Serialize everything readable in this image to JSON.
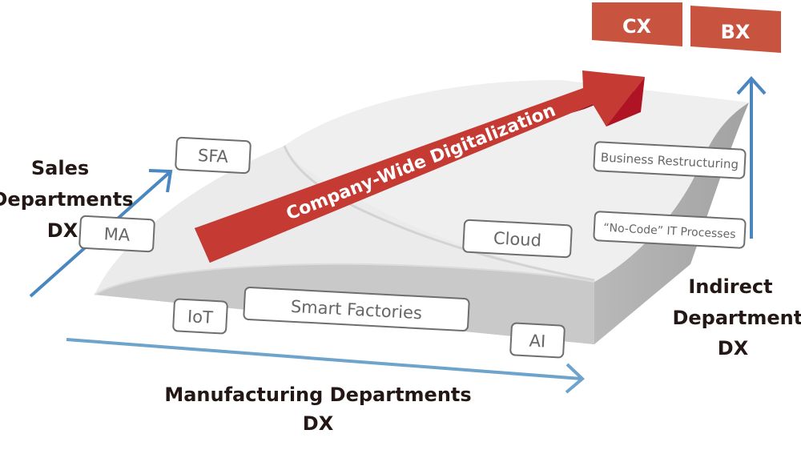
{
  "title": "Company-Wide Digitalization",
  "colors": {
    "accent_red": "#c0392f",
    "badge_red": "#c85440",
    "axis_blue": "#4a86c0",
    "surface_light": "#ececec",
    "surface_mid": "#c8c8c8",
    "surface_dark": "#a9a9a9",
    "tag_border": "#6e6e6e",
    "label_text": "#231815"
  },
  "badges": [
    {
      "label": "CX"
    },
    {
      "label": "BX"
    }
  ],
  "axes": {
    "sales": {
      "line1": "Sales",
      "line2": "Departments",
      "line3": "DX"
    },
    "manufacturing": {
      "line1": "Manufacturing Departments",
      "line2": "DX"
    },
    "indirect": {
      "line1": "Indirect",
      "line2": "Departments",
      "line3": "DX"
    }
  },
  "main_arrow": {
    "label": "Company-Wide Digitalization"
  },
  "tags": {
    "sfa": "SFA",
    "ma": "MA",
    "iot": "IoT",
    "smart_factories": "Smart Factories",
    "ai": "AI",
    "cloud": "Cloud",
    "business_restructuring": "Business Restructuring",
    "no_code": "“No-Code” IT Processes"
  }
}
